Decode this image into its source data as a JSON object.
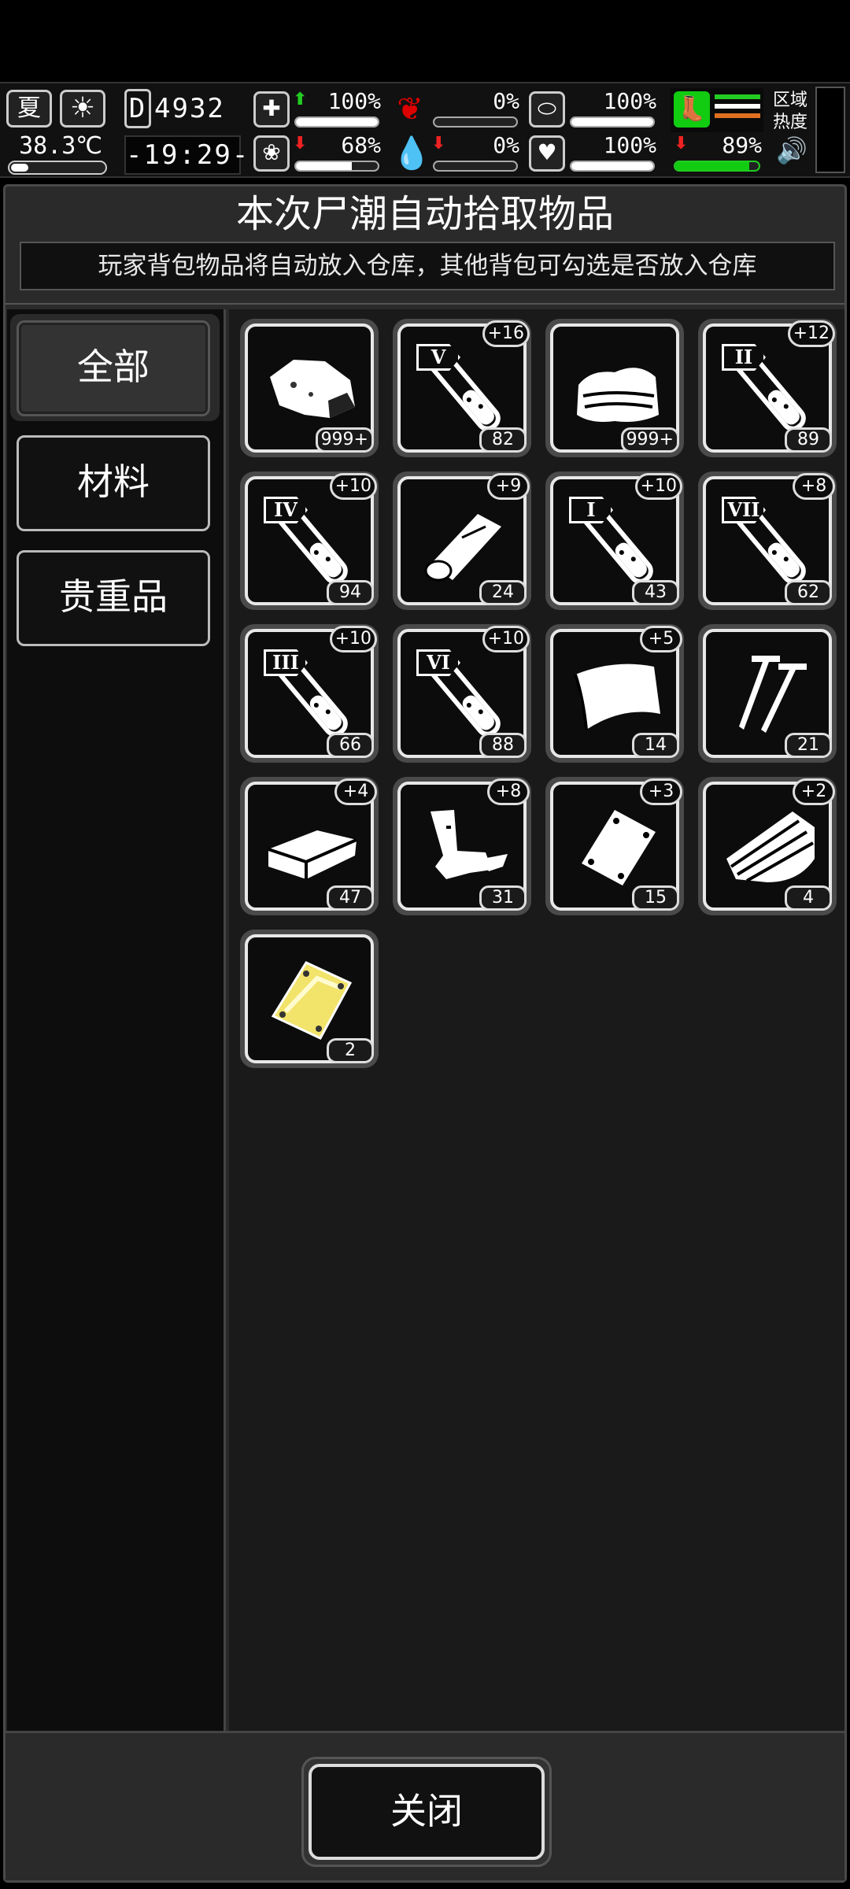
{
  "hud": {
    "season": "夏",
    "temperature": "38.3℃",
    "day_label": "D",
    "day": "4932",
    "clock": "-19:29-",
    "stats": [
      {
        "icon": "medkit-icon",
        "glyph": "✚",
        "trend": "up",
        "trend_glyph": "⬆",
        "value": "100%",
        "level": 1.0
      },
      {
        "icon": "stomach-icon",
        "glyph": "❦",
        "trend": "none",
        "trend_glyph": "",
        "value": "0%",
        "level": 0.0
      },
      {
        "icon": "pill-icon",
        "glyph": "⬭",
        "trend": "none",
        "trend_glyph": "",
        "value": "100%",
        "level": 1.0
      },
      {
        "icon": "brain-icon",
        "glyph": "❀",
        "trend": "down",
        "trend_glyph": "⬇",
        "value": "68%",
        "level": 0.68
      },
      {
        "icon": "blood-drop-icon",
        "glyph": "💧",
        "trend": "down",
        "trend_glyph": "⬇",
        "value": "0%",
        "level": 0.0
      },
      {
        "icon": "heart-icon",
        "glyph": "♥",
        "trend": "none",
        "trend_glyph": "",
        "value": "100%",
        "level": 1.0
      }
    ],
    "stamina": {
      "trend_glyph": "⬇",
      "value": "89%",
      "level": 0.89,
      "color": "#22cc22"
    },
    "leg_stripes": [
      "#22cc22",
      "#ffffff",
      "#e07020"
    ],
    "region_label_1": "区域",
    "region_label_2": "热度"
  },
  "panel": {
    "title": "本次尸潮自动拾取物品",
    "subtitle": "玩家背包物品将自动放入仓库，其他背包可勾选是否放入仓库"
  },
  "tabs": [
    {
      "label": "全部",
      "active": true
    },
    {
      "label": "材料",
      "active": false
    },
    {
      "label": "贵重品",
      "active": false
    }
  ],
  "items": [
    {
      "icon": "raw-meat-icon",
      "tier": "",
      "plus": "",
      "count": "999+"
    },
    {
      "icon": "test-tube-icon",
      "tier": "V",
      "plus": "+16",
      "count": "82"
    },
    {
      "icon": "cloth-icon",
      "tier": "",
      "plus": "",
      "count": "999+"
    },
    {
      "icon": "test-tube-icon",
      "tier": "II",
      "plus": "+12",
      "count": "89"
    },
    {
      "icon": "test-tube-icon",
      "tier": "IV",
      "plus": "+10",
      "count": "94"
    },
    {
      "icon": "wood-log-icon",
      "tier": "",
      "plus": "+9",
      "count": "24"
    },
    {
      "icon": "test-tube-icon",
      "tier": "I",
      "plus": "+10",
      "count": "43"
    },
    {
      "icon": "test-tube-icon",
      "tier": "VII",
      "plus": "+8",
      "count": "62"
    },
    {
      "icon": "test-tube-icon",
      "tier": "III",
      "plus": "+10",
      "count": "66"
    },
    {
      "icon": "test-tube-icon",
      "tier": "VI",
      "plus": "+10",
      "count": "88"
    },
    {
      "icon": "plastic-sheet-icon",
      "tier": "",
      "plus": "+5",
      "count": "14"
    },
    {
      "icon": "screws-icon",
      "tier": "",
      "plus": "",
      "count": "21"
    },
    {
      "icon": "brick-icon",
      "tier": "",
      "plus": "+4",
      "count": "47"
    },
    {
      "icon": "scrap-metal-icon",
      "tier": "",
      "plus": "+8",
      "count": "31"
    },
    {
      "icon": "steel-plate-icon",
      "tier": "",
      "plus": "+3",
      "count": "15"
    },
    {
      "icon": "wood-planks-icon",
      "tier": "",
      "plus": "+2",
      "count": "4"
    },
    {
      "icon": "gold-plate-icon",
      "tier": "",
      "plus": "",
      "count": "2"
    }
  ],
  "footer": {
    "close_label": "关闭"
  }
}
